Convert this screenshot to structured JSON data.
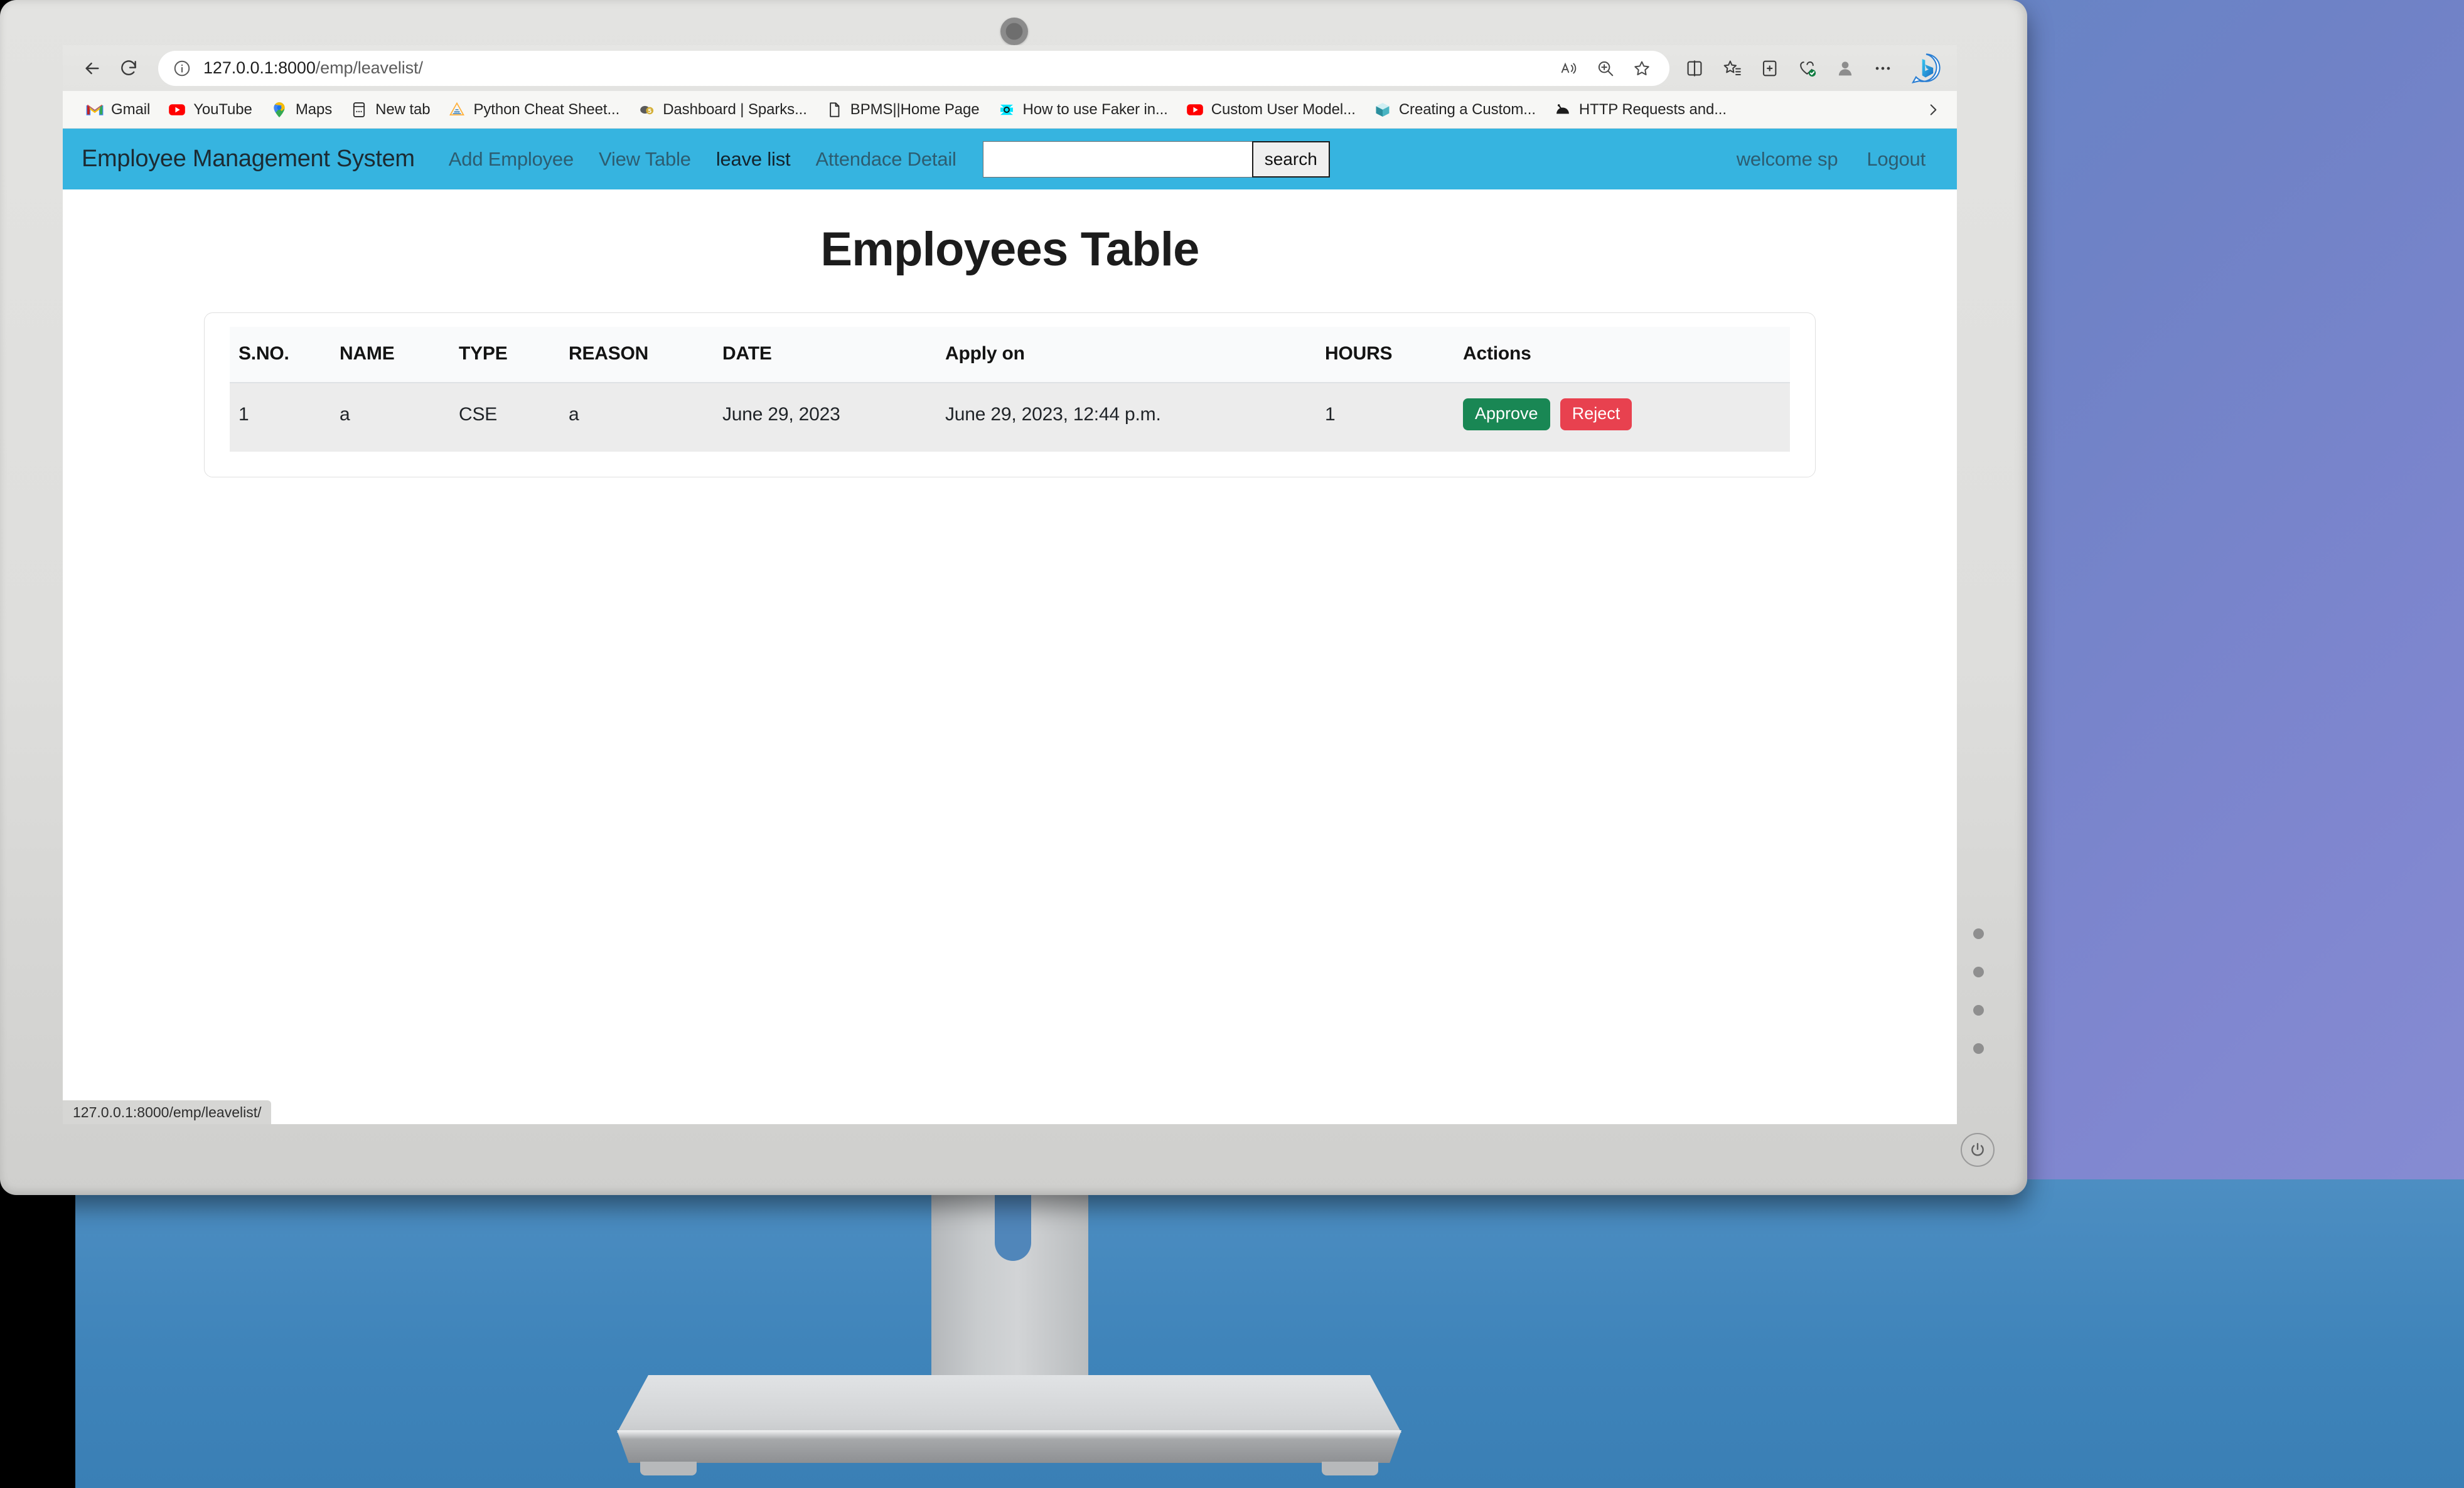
{
  "browser": {
    "back_label": "Back",
    "refresh_label": "Refresh",
    "info_label": "View site information",
    "url_host": "127.0.0.1:8000",
    "url_path": "/emp/leavelist/",
    "url_full": "127.0.0.1:8000/emp/leavelist/",
    "addr_actions": [
      {
        "name": "read-aloud-icon",
        "label": "Read aloud"
      },
      {
        "name": "zoom-icon",
        "label": "Zoom"
      },
      {
        "name": "favorite-star-icon",
        "label": "Add this page to favorites"
      }
    ],
    "toolbar_icons": [
      {
        "name": "split-screen-icon",
        "label": "Split screen"
      },
      {
        "name": "favorites-icon",
        "label": "Favorites"
      },
      {
        "name": "collections-icon",
        "label": "Collections"
      },
      {
        "name": "browser-essentials-icon",
        "label": "Browser essentials"
      },
      {
        "name": "profile-icon",
        "label": "Profile"
      },
      {
        "name": "more-options-icon",
        "label": "Settings and more"
      }
    ],
    "copilot_label": "Copilot",
    "status_bar_url": "127.0.0.1:8000/emp/leavelist/"
  },
  "bookmarks": [
    {
      "label": "Gmail",
      "icon": "gmail-icon"
    },
    {
      "label": "YouTube",
      "icon": "youtube-icon"
    },
    {
      "label": "Maps",
      "icon": "maps-icon"
    },
    {
      "label": "New tab",
      "icon": "new-tab-icon"
    },
    {
      "label": "Python Cheat Sheet...",
      "icon": "python-icon"
    },
    {
      "label": "Dashboard | Sparks...",
      "icon": "sparks-icon"
    },
    {
      "label": "BPMS||Home Page",
      "icon": "document-icon"
    },
    {
      "label": "How to use Faker in...",
      "icon": "faker-icon"
    },
    {
      "label": "Custom User Model...",
      "icon": "youtube-icon"
    },
    {
      "label": "Creating a Custom...",
      "icon": "cube-icon"
    },
    {
      "label": "HTTP Requests and...",
      "icon": "bridge-icon"
    }
  ],
  "app": {
    "brand": "Employee Management System",
    "nav_links": [
      {
        "label": "Add Employee",
        "active": false
      },
      {
        "label": "View Table",
        "active": false
      },
      {
        "label": "leave list",
        "active": true
      },
      {
        "label": "Attendace Detail",
        "active": false
      }
    ],
    "search": {
      "value": "",
      "placeholder": "",
      "button_label": "search"
    },
    "welcome": "welcome sp",
    "logout": "Logout",
    "navbar_color": "#36b4e0"
  },
  "page": {
    "title": "Employees Table",
    "table": {
      "columns": [
        "S.NO.",
        "NAME",
        "TYPE",
        "REASON",
        "DATE",
        "Apply on",
        "HOURS",
        "Actions"
      ],
      "rows": [
        {
          "sno": "1",
          "name": "a",
          "type": "CSE",
          "reason": "a",
          "date": "June 29, 2023",
          "apply_on": "June 29, 2023, 12:44 p.m.",
          "hours": "1",
          "approve_label": "Approve",
          "reject_label": "Reject"
        }
      ],
      "approve_color": "#198754",
      "reject_color": "#e8414f"
    }
  }
}
